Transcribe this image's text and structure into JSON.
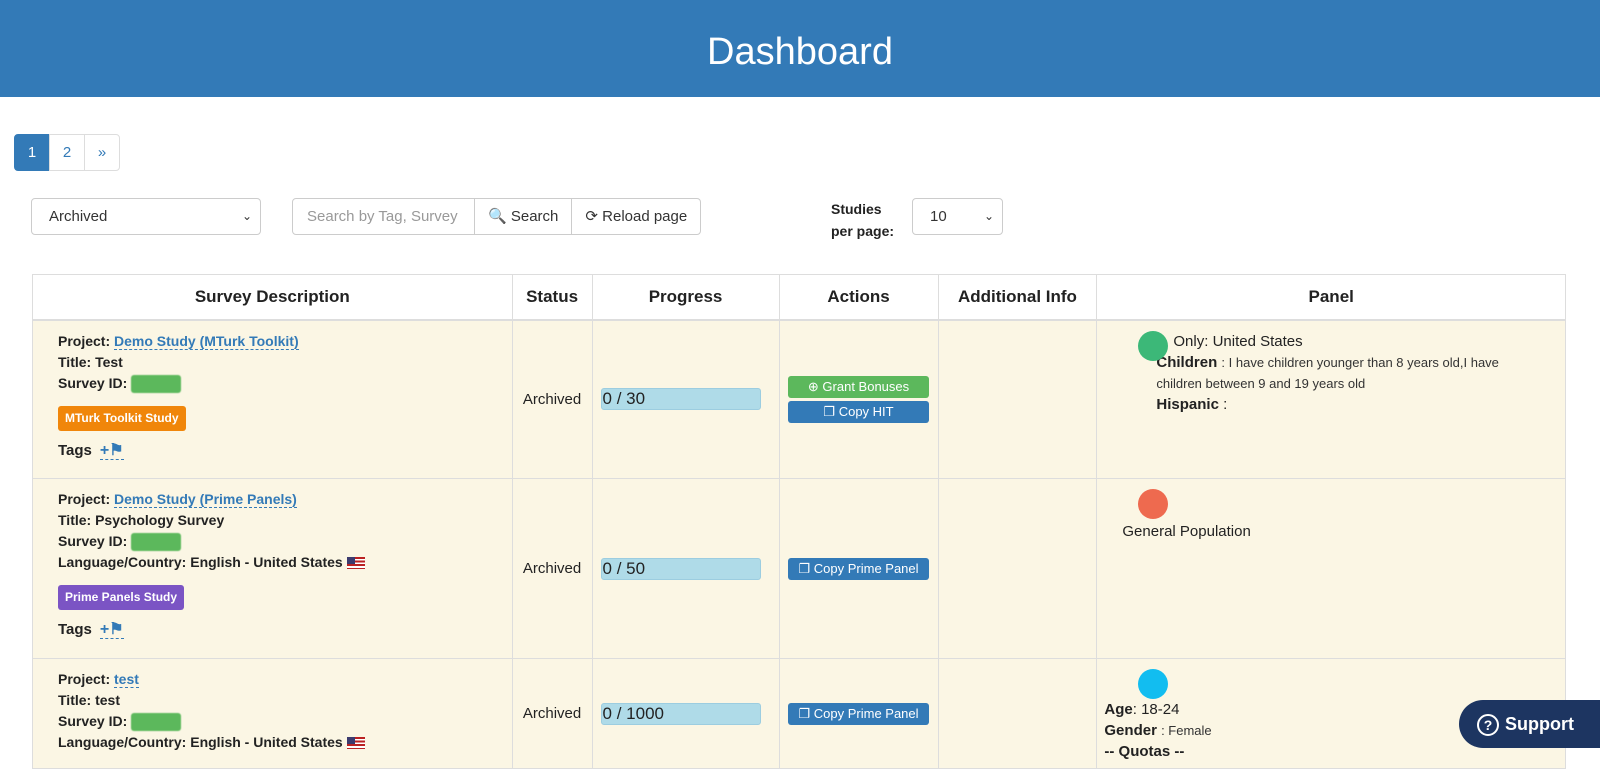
{
  "header": {
    "title": "Dashboard"
  },
  "pagination": {
    "pages": [
      "1",
      "2"
    ],
    "next": "»"
  },
  "filter": {
    "selected": "Archived"
  },
  "search": {
    "placeholder": "Search by Tag, Survey",
    "search_label": "Search",
    "reload_label": "Reload page"
  },
  "per_page": {
    "label": "Studies per page:",
    "selected": "10"
  },
  "table": {
    "columns": [
      "Survey Description",
      "Status",
      "Progress",
      "Actions",
      "Additional Info",
      "Panel"
    ],
    "rows": [
      {
        "project_label": "Project:",
        "project": "Demo Study (MTurk Toolkit)",
        "title_label": "Title:",
        "title": "Test",
        "survey_id_label": "Survey ID:",
        "badge": "MTurk Toolkit Study",
        "tags_label": "Tags",
        "status": "Archived",
        "progress": "0 / 30",
        "actions": [
          "Grant Bonuses",
          "Copy HIT"
        ],
        "panel": {
          "only": "Only: United States",
          "children_label": "Children",
          "children": ": I have children younger than 8 years old,I have children between 9 and 19 years old",
          "hispanic_label": "Hispanic",
          "hispanic": ":"
        }
      },
      {
        "project_label": "Project:",
        "project": "Demo Study (Prime Panels)",
        "title_label": "Title:",
        "title": "Psychology Survey",
        "survey_id_label": "Survey ID:",
        "lang_label": "Language/Country:",
        "lang": "English - United States",
        "badge": "Prime Panels Study",
        "tags_label": "Tags",
        "status": "Archived",
        "progress": "0 / 50",
        "actions": [
          "Copy Prime Panel"
        ],
        "panel": {
          "text": "General Population"
        }
      },
      {
        "project_label": "Project:",
        "project": "test",
        "title_label": "Title:",
        "title": "test",
        "survey_id_label": "Survey ID:",
        "lang_label": "Language/Country:",
        "lang": "English - United States",
        "status": "Archived",
        "progress": "0 / 1000",
        "actions": [
          "Copy Prime Panel"
        ],
        "panel": {
          "age_label": "Age",
          "age": ": 18-24",
          "gender_label": "Gender",
          "gender": ": Female",
          "quotas": "-- Quotas --"
        }
      }
    ]
  },
  "support": {
    "label": "Support"
  },
  "colors": {
    "primary": "#337ab7",
    "success": "#5cb85c",
    "row_bg": "#fbf6e4",
    "dot_1": "#3cb878",
    "dot_2": "#ee6a4f",
    "dot_3": "#12bdf0"
  }
}
